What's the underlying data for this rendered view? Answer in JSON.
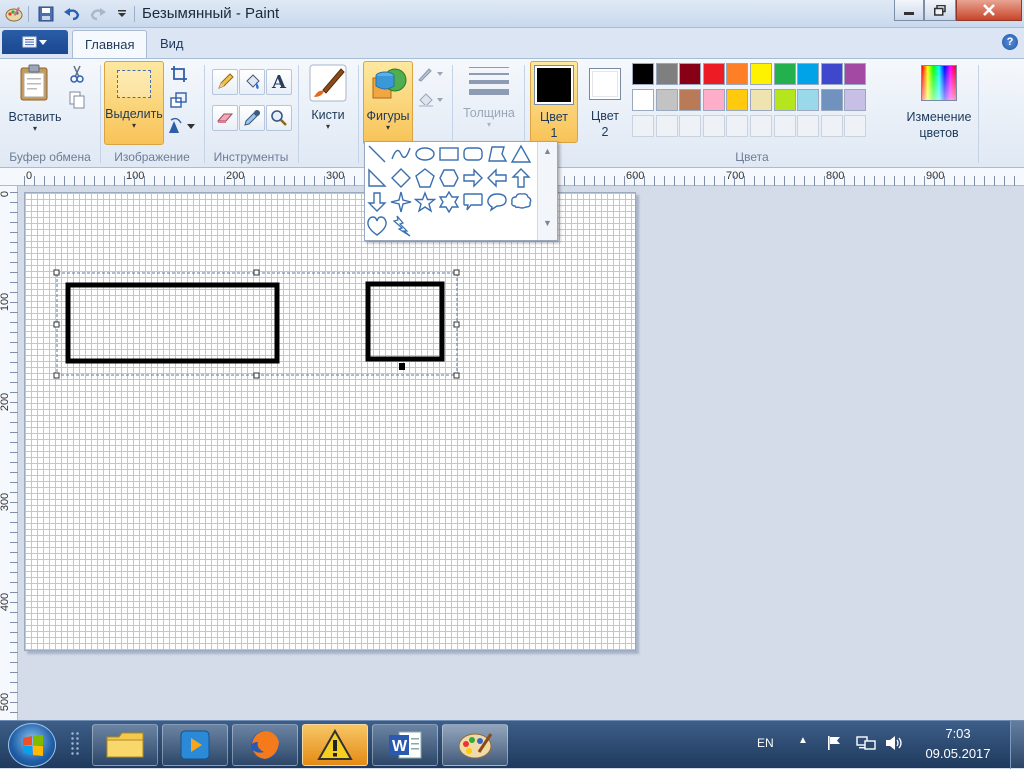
{
  "window": {
    "title": "Безымянный - Paint"
  },
  "tabs": [
    {
      "label": "Главная",
      "active": true
    },
    {
      "label": "Вид",
      "active": false
    }
  ],
  "ribbon": {
    "clipboard": {
      "paste_label": "Вставить",
      "group_label": "Буфер обмена"
    },
    "image": {
      "select_label": "Выделить",
      "group_label": "Изображение"
    },
    "tools": {
      "group_label": "Инструменты"
    },
    "brushes": {
      "label": "Кисти"
    },
    "shapes": {
      "label": "Фигуры"
    },
    "thickness": {
      "label": "Толщина"
    },
    "color1": {
      "label_line1": "Цвет",
      "label_line2": "1",
      "value": "#000000"
    },
    "color2": {
      "label_line1": "Цвет",
      "label_line2": "2",
      "value": "#ffffff"
    },
    "edit_colors": {
      "label_line1": "Изменение",
      "label_line2": "цветов"
    },
    "colors_group_label": "Цвета",
    "palette_row1": [
      "#000000",
      "#7f7f7f",
      "#880015",
      "#ed1c24",
      "#ff7f27",
      "#fff200",
      "#22b14c",
      "#00a2e8",
      "#3f48cc",
      "#a349a4"
    ],
    "palette_row2": [
      "#ffffff",
      "#c3c3c3",
      "#b97a57",
      "#ffaec9",
      "#ffc90e",
      "#efe4b0",
      "#b5e61d",
      "#99d9ea",
      "#7092be",
      "#c8bfe7"
    ]
  },
  "ruler": {
    "top_labels": [
      "0",
      "100",
      "200",
      "300",
      "600",
      "700",
      "800",
      "900"
    ],
    "left_labels": [
      "0",
      "100",
      "200",
      "300",
      "400",
      "500"
    ]
  },
  "shapes_menu": {
    "items": [
      "line-icon",
      "curve-icon",
      "oval-icon",
      "rectangle-icon",
      "rounded-rectangle-icon",
      "polygon-icon",
      "triangle-icon",
      "right-triangle-icon",
      "diamond-icon",
      "pentagon-icon",
      "hexagon-icon",
      "right-arrow-icon",
      "left-arrow-icon",
      "up-arrow-icon",
      "down-arrow-icon",
      "four-point-star-icon",
      "five-point-star-icon",
      "six-point-star-icon",
      "rounded-callout-icon",
      "oval-callout-icon",
      "cloud-callout-icon",
      "heart-icon",
      "lightning-icon"
    ]
  },
  "taskbar": {
    "language": "EN",
    "time": "7:03",
    "date": "09.05.2017"
  }
}
